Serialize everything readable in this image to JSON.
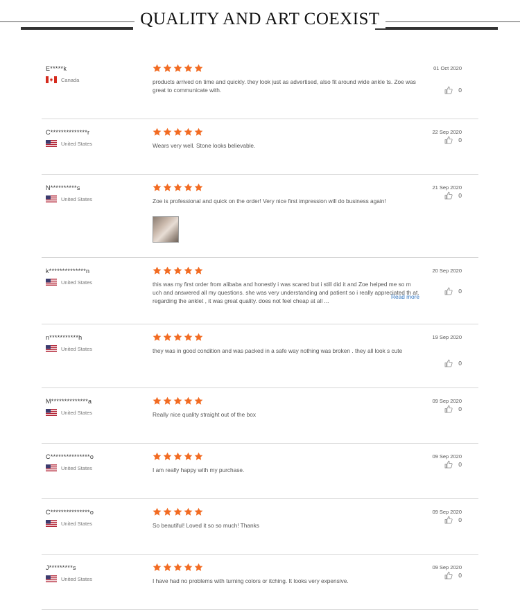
{
  "header": {
    "title": "QUALITY AND ART COEXIST"
  },
  "colors": {
    "star": "#f26b22",
    "link": "#2f74c0",
    "divider": "#d6d6d6"
  },
  "reviews": [
    {
      "name": "E*****k",
      "country": "Canada",
      "flag": "canada-flag-icon",
      "rating": 5,
      "text": "products arrived on time and quickly. they look just as advertised, also fit around wide ankle ts. Zoe was great to communicate with.",
      "date": "01 Oct 2020",
      "likes": "0"
    },
    {
      "name": "C**************r",
      "country": "United States",
      "flag": "us-flag-icon",
      "rating": 5,
      "text": "Wears very well. Stone looks believable.",
      "date": "22 Sep 2020",
      "likes": "0"
    },
    {
      "name": "N**********s",
      "country": "United States",
      "flag": "us-flag-icon",
      "rating": 5,
      "text": "Zoe is professional and quick on the order! Very nice first impression will do business again!",
      "date": "21 Sep 2020",
      "likes": "0",
      "has_photo": true
    },
    {
      "name": "k**************n",
      "country": "United States",
      "flag": "us-flag-icon",
      "rating": 5,
      "text": "this was my first order from alibaba and honestly i was scared but i still did it and Zoe helped me so m uch and answered all my questions. she was very understanding and patient so i really appreciated th at. regarding the anklet , it was great quality. does not feel cheap at all ...",
      "read_more": "Read more",
      "date": "20 Sep 2020",
      "likes": "0"
    },
    {
      "name": "n***********h",
      "country": "United States",
      "flag": "us-flag-icon",
      "rating": 5,
      "text": "they was in good condition and was packed in a safe way nothing was broken . they all look s cute",
      "date": "19 Sep 2020",
      "likes": "0"
    },
    {
      "name": "M**************a",
      "country": "United States",
      "flag": "us-flag-icon",
      "rating": 5,
      "text": "Really nice quality straight out of the box",
      "date": "09 Sep 2020",
      "likes": "0"
    },
    {
      "name": "C***************o",
      "country": "United States",
      "flag": "us-flag-icon",
      "rating": 5,
      "text": "I am really happy with my purchase.",
      "date": "09 Sep 2020",
      "likes": "0"
    },
    {
      "name": "C***************o",
      "country": "United States",
      "flag": "us-flag-icon",
      "rating": 5,
      "text": "So beautiful! Loved it so so much! Thanks",
      "date": "09 Sep 2020",
      "likes": "0"
    },
    {
      "name": "J*********s",
      "country": "United States",
      "flag": "us-flag-icon",
      "rating": 5,
      "text": "I have had no problems with turning colors or itching. It looks very expensive.",
      "date": "09 Sep 2020",
      "likes": "0"
    }
  ]
}
